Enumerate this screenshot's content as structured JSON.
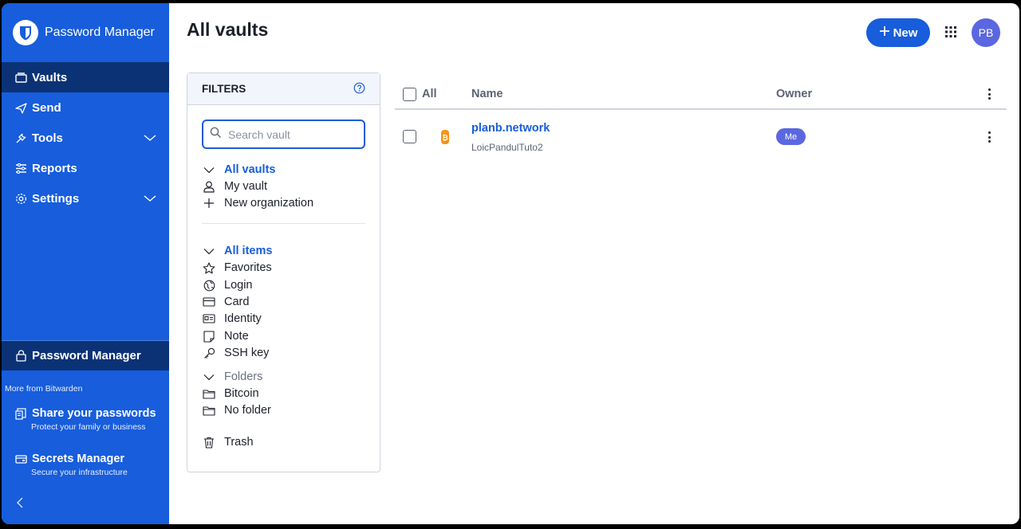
{
  "app": {
    "title": "Password Manager"
  },
  "sidebar": {
    "items": [
      {
        "label": "Vaults",
        "icon": "vault-icon",
        "active": true
      },
      {
        "label": "Send",
        "icon": "send-icon"
      },
      {
        "label": "Tools",
        "icon": "tools-icon",
        "expandable": true
      },
      {
        "label": "Reports",
        "icon": "reports-icon"
      },
      {
        "label": "Settings",
        "icon": "settings-icon",
        "expandable": true
      }
    ],
    "product_label": "Password Manager",
    "more_from": "More from Bitwarden",
    "promos": [
      {
        "title": "Share your passwords",
        "subtitle": "Protect your family or business",
        "icon": "share-icon"
      },
      {
        "title": "Secrets Manager",
        "subtitle": "Secure your infrastructure",
        "icon": "secrets-icon"
      }
    ]
  },
  "header": {
    "title": "All vaults",
    "new_label": "New",
    "avatar_initials": "PB"
  },
  "filters": {
    "title": "FILTERS",
    "search_placeholder": "Search vault",
    "vaults": [
      {
        "label": "All vaults",
        "selected": true,
        "icon": "chevron-down-icon"
      },
      {
        "label": "My vault",
        "icon": "user-icon"
      },
      {
        "label": "New organization",
        "icon": "plus-icon"
      }
    ],
    "types": [
      {
        "label": "All items",
        "selected": true,
        "icon": "chevron-down-icon"
      },
      {
        "label": "Favorites",
        "icon": "star-icon"
      },
      {
        "label": "Login",
        "icon": "globe-icon"
      },
      {
        "label": "Card",
        "icon": "card-icon"
      },
      {
        "label": "Identity",
        "icon": "id-card-icon"
      },
      {
        "label": "Note",
        "icon": "note-icon"
      },
      {
        "label": "SSH key",
        "icon": "key-icon"
      }
    ],
    "folders_label": "Folders",
    "folders": [
      {
        "label": "Bitcoin",
        "icon": "folder-icon"
      },
      {
        "label": "No folder",
        "icon": "folder-icon"
      }
    ],
    "trash_label": "Trash"
  },
  "table": {
    "headers": {
      "all": "All",
      "name": "Name",
      "owner": "Owner"
    },
    "rows": [
      {
        "name": "planb.network",
        "subtitle": "LoicPandulTuto2",
        "owner": "Me"
      }
    ]
  },
  "colors": {
    "brand": "#175ddc",
    "sidebar_active": "#0c3276",
    "badge": "#5a67e0"
  }
}
